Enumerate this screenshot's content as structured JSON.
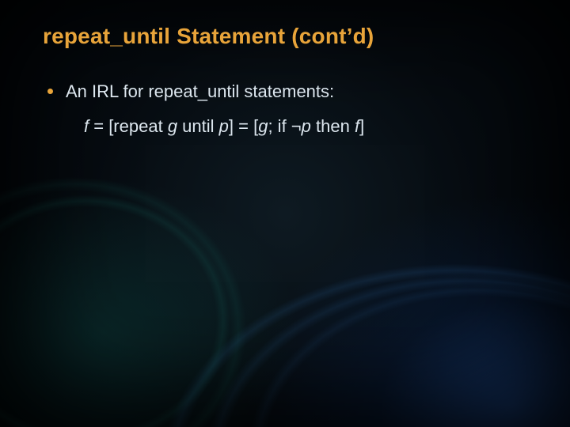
{
  "slide": {
    "title": "repeat_until Statement (cont’d)",
    "bullet1": "An IRL for repeat_until statements:",
    "formula": {
      "f1": "f",
      "eq1": " = [repeat ",
      "g": "g",
      "mid1": " until ",
      "p1": "p",
      "mid2": "] = [",
      "g2": "g",
      "mid3": "; if ¬",
      "p2": "p",
      "mid4": " then ",
      "f2": "f",
      "end": "]"
    }
  }
}
